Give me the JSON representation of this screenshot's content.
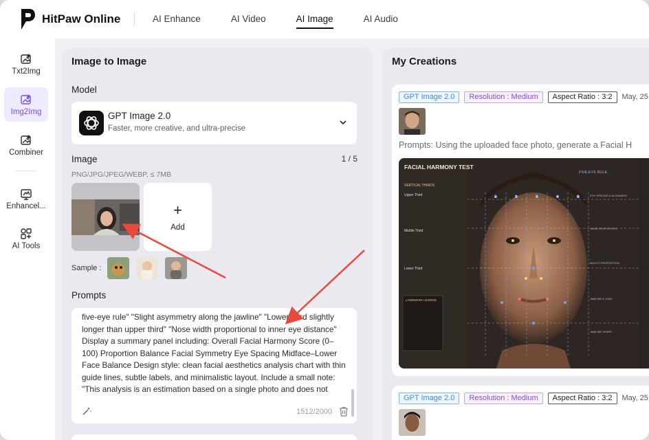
{
  "brand": {
    "name": "HitPaw Online"
  },
  "nav": {
    "items": [
      {
        "label": "AI Enhance",
        "active": false
      },
      {
        "label": "AI Video",
        "active": false
      },
      {
        "label": "AI Image",
        "active": true
      },
      {
        "label": "AI Audio",
        "active": false
      }
    ]
  },
  "rail": {
    "items": [
      {
        "label": "Txt2Img",
        "icon": "image-text-icon",
        "active": false
      },
      {
        "label": "Img2Img",
        "icon": "image-convert-icon",
        "active": true
      },
      {
        "label": "Combiner",
        "icon": "image-combine-icon",
        "active": false
      },
      {
        "label": "Enhancel...",
        "icon": "enhance-icon",
        "active": false
      },
      {
        "label": "AI Tools",
        "icon": "tools-grid-icon",
        "active": false
      }
    ]
  },
  "panel": {
    "title": "Image to Image",
    "model_label": "Model",
    "model": {
      "name": "GPT Image 2.0",
      "description": "Faster, more creative, and ultra-precise"
    },
    "image_label": "Image",
    "image_count": "1 / 5",
    "image_hint": "PNG/JPG/JPEG/WEBP, ≤ 7MB",
    "add_label": "Add",
    "sample_label": "Sample :",
    "prompts_label": "Prompts",
    "prompt_text": "five-eye rule\" \"Slight asymmetry along the jawline\" \"Lower third slightly longer than upper third\" \"Nose width proportional to inner eye distance\" Display a summary panel including: Overall Facial Harmony Score (0–100) Proportion Balance Facial Symmetry Eye Spacing Midface–Lower Face Balance Design style: clean facial aesthetics analysis chart with thin guide lines, subtle labels, and minimalistic layout. Include a small note: \"This analysis is an estimation based on a single photo and does not represent medical advice.\"",
    "char_count": "1512/2000"
  },
  "creations": {
    "title": "My Creations",
    "cards": [
      {
        "model_tag": "GPT Image 2.0",
        "resolution_tag": "Resolution : Medium",
        "ratio_tag": "Aspect Ratio : 3:2",
        "date": "May, 25",
        "prompt": "Prompts: Using the uploaded face photo, generate a Facial H",
        "result": {
          "heading": "FACIAL HARMONY TEST",
          "vertical_thirds": "VERTICAL THIRDS",
          "upper_third": "Upper Third",
          "middle_third": "Middle Third",
          "lower_third": "Lower Third",
          "five_eye_rule": "FIVE-EYE RULE",
          "columns": [
            "1",
            "2",
            "3",
            "4",
            "5"
          ],
          "legend_title": "LANDMARK LEGEND",
          "sections": [
            "EYE SPACING & ALIGNMENT",
            "NOSE PROPORTION",
            "MOUTH PROPORTION",
            "JAWLINE & CHIN",
            "JAWLINE SHAPE"
          ]
        }
      },
      {
        "model_tag": "GPT Image 2.0",
        "resolution_tag": "Resolution : Medium",
        "ratio_tag": "Aspect Ratio : 3:2",
        "date": "May, 25"
      }
    ]
  }
}
